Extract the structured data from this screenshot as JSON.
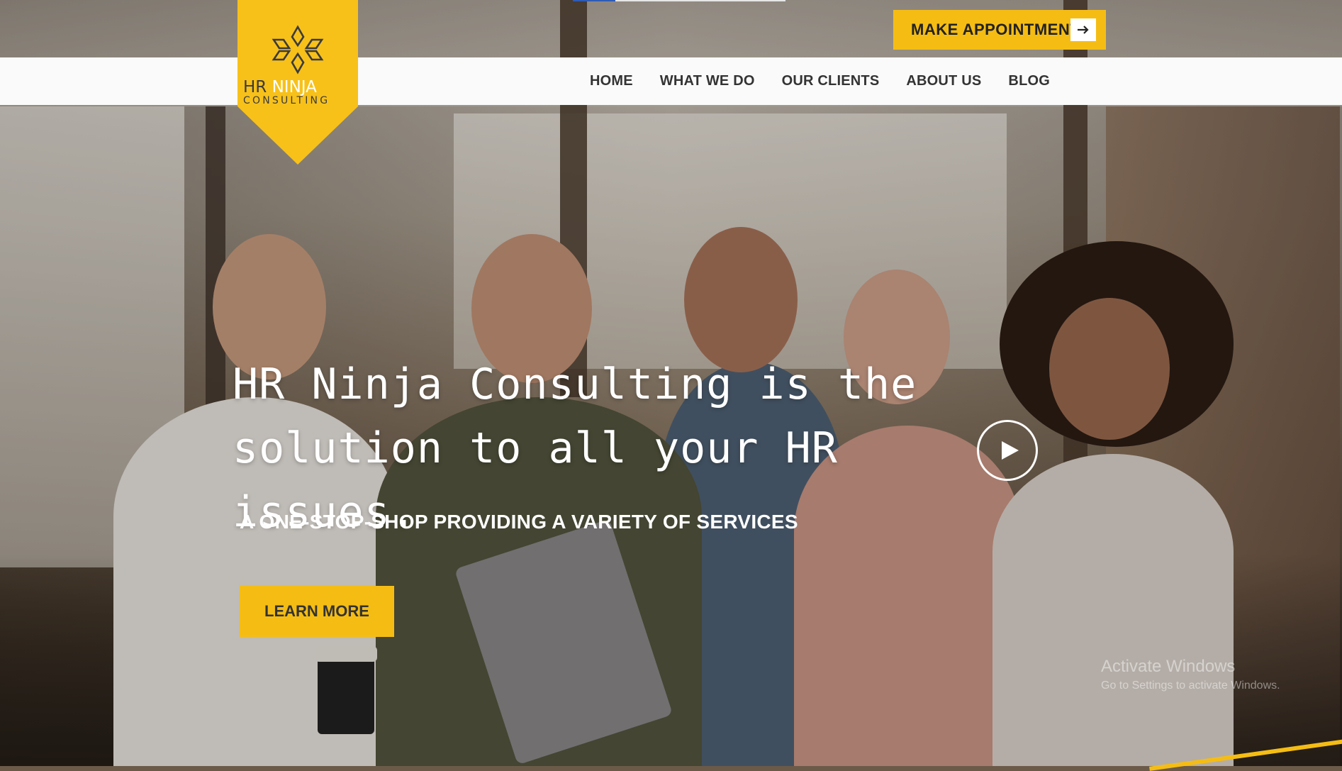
{
  "brand": {
    "logo_name_part1": "HR",
    "logo_name_part2": "NINJA",
    "logo_sub": "CONSULTING",
    "accent_color": "#f5bd14"
  },
  "header": {
    "appointment_button": "MAKE APPOINTMENT",
    "appointment_icon": "arrow-right-icon"
  },
  "nav": {
    "items": [
      {
        "label": "HOME"
      },
      {
        "label": "WHAT WE DO"
      },
      {
        "label": "OUR CLIENTS"
      },
      {
        "label": "ABOUT US"
      },
      {
        "label": "BLOG"
      }
    ]
  },
  "hero": {
    "headline_line1": "HR Ninja Consulting is the",
    "headline_line2": "solution to all your HR issues.",
    "subheading": "A ONE-STOP-SHOP PROVIDING A VARIETY OF SERVICES",
    "cta_label": "LEARN MORE",
    "play_icon": "play-icon"
  },
  "watermark": {
    "line1": "Activate Windows",
    "line2": "Go to Settings to activate Windows."
  }
}
